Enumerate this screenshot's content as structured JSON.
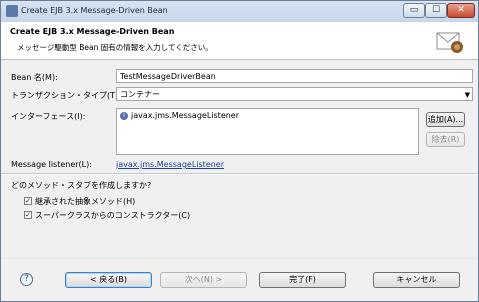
{
  "window": {
    "title": "Create EJB 3.x Message-Driven Bean",
    "buttons": {
      "minimize": "▭",
      "maximize": "☐",
      "close": "✕"
    }
  },
  "header": {
    "title": "Create EJB 3.x Message-Driven Bean",
    "description": "メッセージ駆動型 Bean 固有の情報を入力してください。",
    "banner_icon": "envelope-icon"
  },
  "form": {
    "bean_name_label": "Bean 名(M):",
    "bean_name_value": "TestMessageDriverBean",
    "transaction_label": "トランザクション・タイプ(T):",
    "transaction_value": "コンテナー",
    "interfaces_label": "インターフェース(I):",
    "interfaces": [
      {
        "icon": "interface-icon",
        "name": "javax.jms.MessageListener"
      }
    ],
    "add_button": "追加(A)...",
    "remove_button": "除去(R)",
    "message_listener_label": "Message listener(L):",
    "message_listener_link": "javax.jms.MessageListener",
    "stubs_question": "どのメソッド・スタブを作成しますか?",
    "inherited_abstract_label": "継承された抽象メソッド(H)",
    "inherited_abstract_checked": true,
    "superclass_ctor_label": "スーパークラスからのコンストラクター(C)",
    "superclass_ctor_checked": true
  },
  "footer": {
    "help_icon": "help-icon",
    "back_button": "< 戻る(B)",
    "next_button": "次へ(N) >",
    "finish_button": "完了(F)",
    "cancel_button": "キャンセル"
  }
}
